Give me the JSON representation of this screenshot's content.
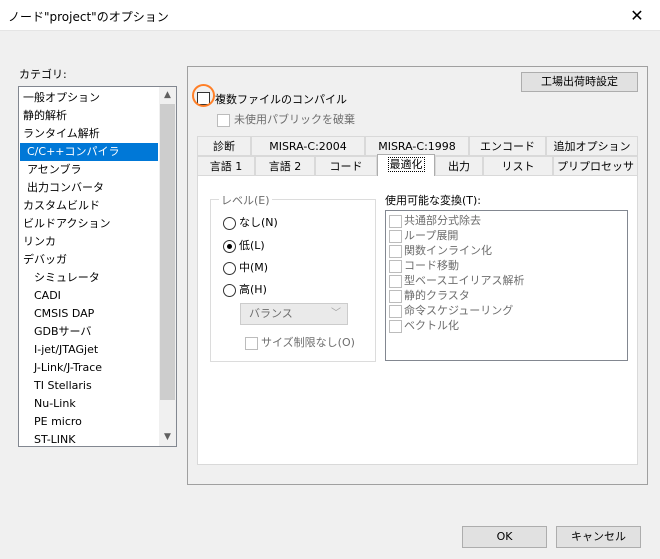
{
  "window": {
    "title": "ノード\"project\"のオプション",
    "close_glyph": "✕"
  },
  "category": {
    "label": "カテゴリ:",
    "items": [
      "一般オプション",
      "静的解析",
      "ランタイム解析",
      "C/C++コンパイラ",
      "アセンブラ",
      "出力コンバータ",
      "カスタムビルド",
      "ビルドアクション",
      "リンカ",
      "デバッガ",
      "シミュレータ",
      "CADI",
      "CMSIS DAP",
      "GDBサーバ",
      "I-jet/JTAGjet",
      "J-Link/J-Trace",
      "TI Stellaris",
      "Nu-Link",
      "PE micro",
      "ST-LINK"
    ],
    "selected_index": 3
  },
  "factory_button": "工場出荷時設定",
  "multi_file": {
    "label": "複数ファイルのコンパイル",
    "checked": false
  },
  "unused_public": {
    "label": "未使用パブリックを破棄",
    "checked": false,
    "enabled": false
  },
  "tabs_row1": [
    "診断",
    "MISRA-C:2004",
    "MISRA-C:1998",
    "エンコード",
    "追加オプション"
  ],
  "tabs_row2": [
    "言語 1",
    "言語 2",
    "コード",
    "最適化",
    "出力",
    "リスト",
    "プリプロセッサ"
  ],
  "active_tab": "最適化",
  "level": {
    "label": "レベル(E)",
    "options": [
      "なし(N)",
      "低(L)",
      "中(M)",
      "高(H)"
    ],
    "selected": "低(L)",
    "high_mode": "バランス",
    "size_unlimited": "サイズ制限なし(O)"
  },
  "transforms": {
    "label": "使用可能な変換(T):",
    "items": [
      "共通部分式除去",
      "ループ展開",
      "関数インライン化",
      "コード移動",
      "型ベースエイリアス解析",
      "静的クラスタ",
      "命令スケジューリング",
      "ベクトル化"
    ]
  },
  "buttons": {
    "ok": "OK",
    "cancel": "キャンセル"
  },
  "colors": {
    "selection": "#0078d7",
    "highlight_ring": "#ff7f27"
  }
}
